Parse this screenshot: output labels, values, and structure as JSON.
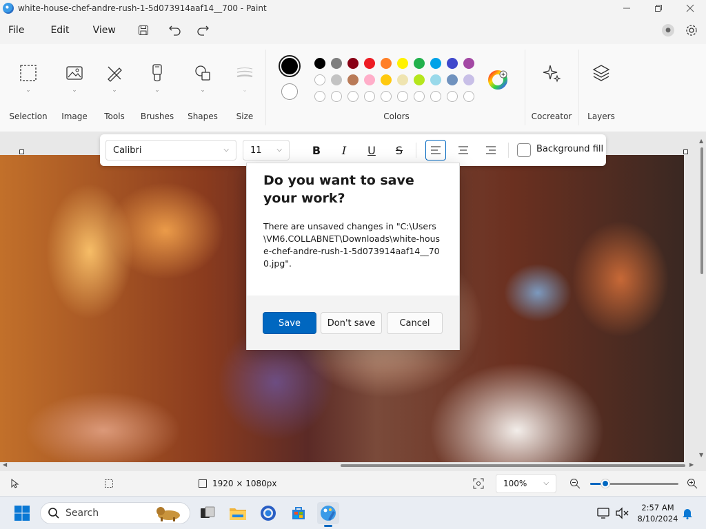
{
  "window": {
    "title": "white-house-chef-andre-rush-1-5d073914aaf14__700 - Paint",
    "app_icon": "paint-icon"
  },
  "menu": {
    "file": "File",
    "edit": "Edit",
    "view": "View"
  },
  "ribbon": {
    "groups": {
      "selection": "Selection",
      "image": "Image",
      "tools": "Tools",
      "brushes": "Brushes",
      "shapes": "Shapes",
      "size": "Size",
      "colors": "Colors",
      "cocreator": "Cocreator",
      "layers": "Layers"
    },
    "primary_color": "#000000",
    "secondary_color": "#ffffff",
    "palette_row1": [
      "#000000",
      "#7f7f7f",
      "#880015",
      "#ed1c24",
      "#ff7f27",
      "#fff200",
      "#22b14c",
      "#00a2e8",
      "#3f48cc",
      "#a349a4"
    ],
    "palette_row2": [
      "",
      "#c3c3c3",
      "#b97a57",
      "#ffaec9",
      "#ffc90e",
      "#efe4b0",
      "#b5e61d",
      "#99d9ea",
      "#7092be",
      "#c8bfe7"
    ]
  },
  "text_toolbar": {
    "font": "Calibri",
    "size": "11",
    "background_fill": "Background fill"
  },
  "dialog": {
    "title": "Do you want to save your work?",
    "message": "There are unsaved changes in \"C:\\Users\\VM6.COLLABNET\\Downloads\\white-house-chef-andre-rush-1-5d073914aaf14__700.jpg\".",
    "save": "Save",
    "dont_save": "Don't save",
    "cancel": "Cancel"
  },
  "status": {
    "dimensions": "1920 × 1080px",
    "zoom": "100%",
    "zoom_level": 0.17
  },
  "taskbar": {
    "search_placeholder": "Search",
    "time": "2:57 AM",
    "date": "8/10/2024"
  },
  "colors": {
    "accent": "#0067c0"
  }
}
